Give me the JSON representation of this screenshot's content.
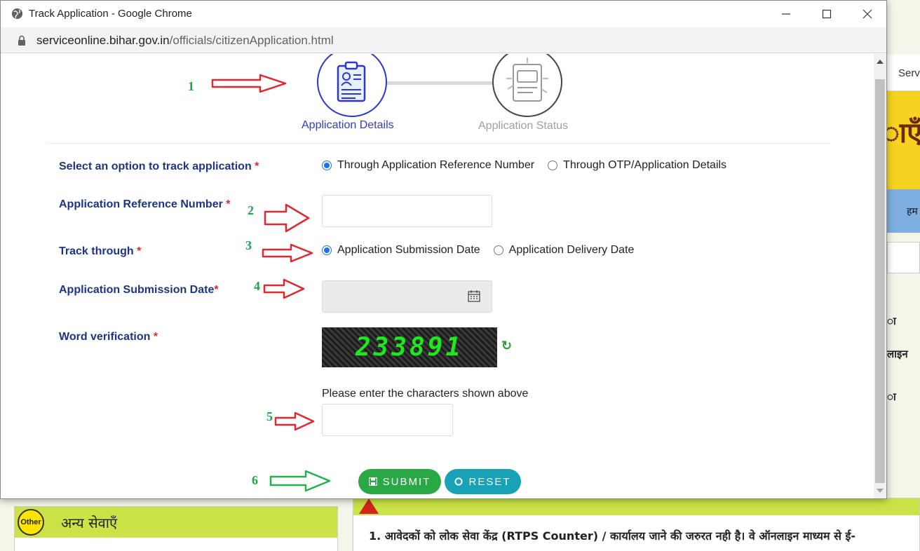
{
  "window": {
    "title": "Track Application - Google Chrome",
    "url_domain": "serviceonline.bihar.gov.in",
    "url_path": "/officials/citizenApplication.html"
  },
  "background": {
    "top_right_text": "Servi",
    "banner_text": "ाएँ",
    "blue_bar_text": "हम",
    "right_texts": [
      "ा",
      "लाइन",
      "ा"
    ],
    "left_panel_badge": "Other",
    "left_panel_title": "अन्य सेवाएँ",
    "right_panel_line": "1. आवेदकों को लोक सेवा केंद्र (RTPS Counter) / कार्यालय जाने की जरुरत नही है। वे ऑनलाइन माध्यम से ई-"
  },
  "steps": [
    {
      "label": "Application Details",
      "active": true
    },
    {
      "label": "Application Status",
      "active": false
    }
  ],
  "form": {
    "track_option": {
      "label": "Select an option to track application",
      "required": "*",
      "options": [
        "Through Application Reference Number",
        "Through OTP/Application Details"
      ],
      "selected": "Through Application Reference Number"
    },
    "reference_number": {
      "label": "Application Reference Number",
      "required": "*",
      "value": ""
    },
    "track_through": {
      "label": "Track through",
      "required": "*",
      "options": [
        "Application Submission Date",
        "Application Delivery Date"
      ],
      "selected": "Application Submission Date"
    },
    "submission_date": {
      "label": "Application Submission Date",
      "required": "*",
      "value": ""
    },
    "word_verification": {
      "label": "Word verification",
      "required": "*",
      "captcha": "233891",
      "hint": "Please enter the characters shown above",
      "value": ""
    },
    "submit_label": "SUBMIT",
    "reset_label": "RESET"
  },
  "annotations": [
    "1",
    "2",
    "3",
    "4",
    "5",
    "6"
  ],
  "colors": {
    "step_active": "#2a36d6",
    "label_blue": "#1f3483",
    "submit_green": "#29a945",
    "reset_teal": "#17a2b8",
    "arrow_red": "#e0282e",
    "arrow_green": "#22b14c"
  }
}
